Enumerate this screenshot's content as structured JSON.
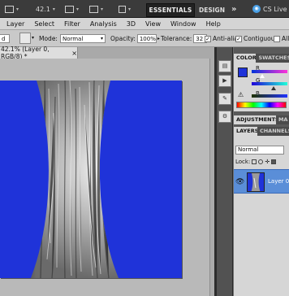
{
  "appbar": {
    "zoom_value": "42.1",
    "workspace_essentials": "ESSENTIALS",
    "workspace_design": "DESIGN",
    "more": "»",
    "cslive": "CS Live"
  },
  "menus": [
    "Layer",
    "Select",
    "Filter",
    "Analysis",
    "3D",
    "View",
    "Window",
    "Help"
  ],
  "options": {
    "mode_label": "Mode:",
    "mode_value": "Normal",
    "opacity_label": "Opacity:",
    "opacity_value": "100%",
    "tolerance_label": "Tolerance:",
    "tolerance_value": "32",
    "antialias_label": "Anti-alias",
    "contiguous_label": "Contiguous",
    "all_label": "All"
  },
  "document_tab": {
    "title": "42.1% (Layer 0, RGB/8) *",
    "close": "×"
  },
  "panels": {
    "color_tabs": [
      "COLOR",
      "SWATCHES"
    ],
    "color_channels": [
      "R",
      "G",
      "B"
    ],
    "adjust_tabs": [
      "ADJUSTMENTS",
      "MA"
    ],
    "layers_tabs": [
      "LAYERS",
      "CHANNELS"
    ],
    "blend_mode": "Normal",
    "lock_label": "Lock:",
    "layer_name": "Layer 0"
  },
  "colors": {
    "canvas_blue": "#1f33d9",
    "layer_selected": "#5a8ed8",
    "foreground": "#1f33d9"
  }
}
